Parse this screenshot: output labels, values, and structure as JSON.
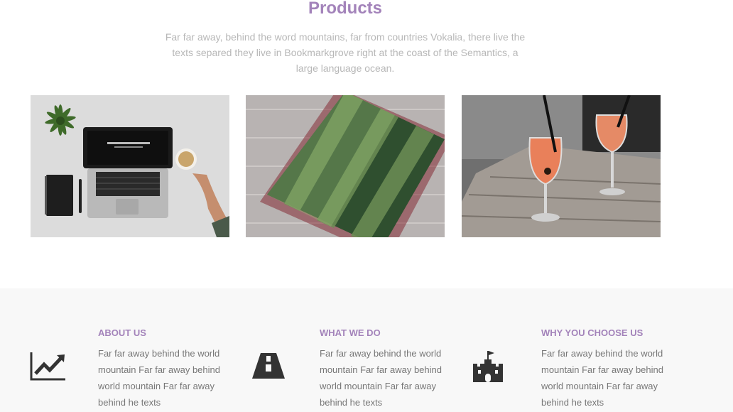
{
  "products": {
    "title": "Products",
    "description": "Far far away, behind the word mountains, far from countries Vokalia, there live the texts separed they live in Bookmarkgrove right at the coast of the Semantics, a large language ocean.",
    "items": [
      {
        "image": "laptop-desk-photo"
      },
      {
        "image": "stadium-aerial-photo"
      },
      {
        "image": "cocktails-table-photo"
      }
    ]
  },
  "features": [
    {
      "icon": "chart-line-icon",
      "title": "ABOUT US",
      "text": "Far far away behind the world mountain Far far away behind world mountain Far far away behind he texts"
    },
    {
      "icon": "road-icon",
      "title": "WHAT WE DO",
      "text": "Far far away behind the world mountain Far far away behind world mountain Far far away behind he texts"
    },
    {
      "icon": "castle-icon",
      "title": "WHY YOU CHOOSE US",
      "text": "Far far away behind the world mountain Far far away behind world mountain Far far away behind he texts"
    }
  ],
  "colors": {
    "accent": "#a383ba",
    "muted_text": "#b7b7b7",
    "body_text": "#777777",
    "section_bg": "#f8f8f8",
    "icon": "#333333"
  }
}
